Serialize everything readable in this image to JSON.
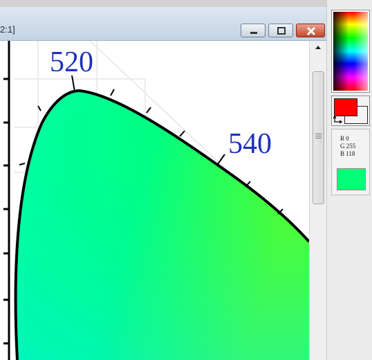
{
  "window": {
    "title_fragment": "2:1]",
    "minimize": "minimize",
    "maximize": "maximize",
    "close": "close"
  },
  "diagram": {
    "labels": [
      "520",
      "540"
    ],
    "label_color": "#1f2fbf"
  },
  "palette": {
    "foreground_color": "#ff0000",
    "background_color": "#f4f4f4"
  },
  "rgb": {
    "r_text": "R  0",
    "g_text": "G  255",
    "b_text": "B  118",
    "color": "#00ff76"
  }
}
